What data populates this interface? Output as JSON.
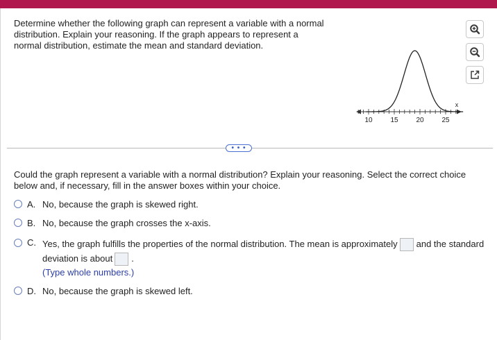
{
  "colors": {
    "top_bar": "#b0174c",
    "link_blue": "#2b3da8",
    "radio_border": "#6a7fb8"
  },
  "question": {
    "line1": "Determine whether the following graph can represent a variable with a normal",
    "line2": "distribution. Explain your reasoning. If the graph appears to represent a",
    "line3": "normal distribution, estimate the mean and standard deviation."
  },
  "toolbar": {
    "zoom_in_icon": "zoom-in-icon",
    "zoom_out_icon": "zoom-out-icon",
    "popout_icon": "popout-icon"
  },
  "graph": {
    "x_label": "x",
    "ticks": [
      "10",
      "15",
      "20",
      "25"
    ]
  },
  "more_button_label": "• • •",
  "prompt": {
    "line1": "Could the graph represent a variable with a normal distribution? Explain your reasoning. Select the correct choice",
    "line2": "below and, if necessary, fill in the answer boxes within your choice."
  },
  "choices": {
    "a": {
      "letter": "A.",
      "text": "No, because the graph is skewed right."
    },
    "b": {
      "letter": "B.",
      "text": "No, because the graph crosses the x-axis."
    },
    "c": {
      "letter": "C.",
      "text_before_mean": "Yes, the graph fulfills the properties of the normal distribution. The mean is approximately",
      "text_after_mean": "and the standard",
      "text_before_sd": "deviation is about",
      "text_after_sd": ".",
      "hint": "(Type whole numbers.)",
      "mean_value": "",
      "sd_value": ""
    },
    "d": {
      "letter": "D.",
      "text": "No, because the graph is skewed left."
    }
  }
}
